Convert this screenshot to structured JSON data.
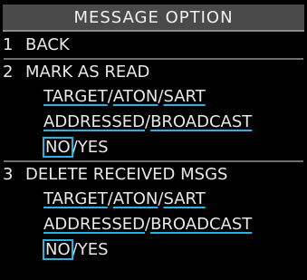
{
  "menu": {
    "title": "MESSAGE OPTION",
    "items": [
      {
        "num": "1",
        "label": "BACK"
      },
      {
        "num": "2",
        "label": "MARK AS READ"
      },
      {
        "num": "3",
        "label": "DELETE RECEIVED MSGS"
      }
    ],
    "mark": {
      "t1": "TARGET",
      "t2": "ATON",
      "t3": "SART",
      "a1": "ADDRESSED",
      "a2": "BROADCAST",
      "no": "NO",
      "yes": "YES"
    },
    "del": {
      "t1": "TARGET",
      "t2": "ATON",
      "t3": "SART",
      "a1": "ADDRESSED",
      "a2": "BROADCAST",
      "no": "NO",
      "yes": "YES"
    },
    "slash": "/"
  },
  "colors": {
    "accent": "#25b4e6",
    "title_bg": "#4a4a4a",
    "bg": "#000000",
    "text": "#e8e8e8"
  }
}
